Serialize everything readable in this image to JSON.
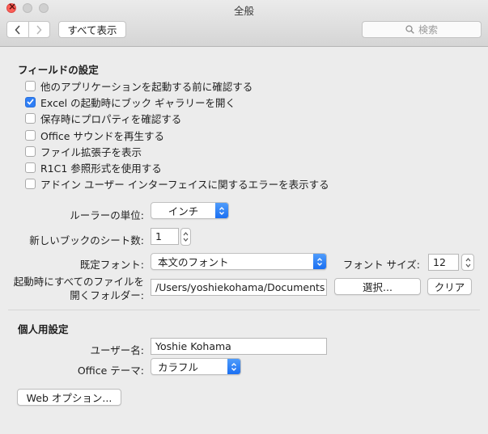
{
  "window": {
    "title": "全般"
  },
  "toolbar": {
    "show_all": "すべて表示",
    "search_placeholder": "検索"
  },
  "fields_section": {
    "title": "フィールドの設定",
    "options": [
      {
        "label": "他のアプリケーションを起動する前に確認する",
        "checked": false
      },
      {
        "label": "Excel の起動時にブック ギャラリーを開く",
        "checked": true
      },
      {
        "label": "保存時にプロパティを確認する",
        "checked": false
      },
      {
        "label": "Office サウンドを再生する",
        "checked": false
      },
      {
        "label": "ファイル拡張子を表示",
        "checked": false
      },
      {
        "label": "R1C1 参照形式を使用する",
        "checked": false
      },
      {
        "label": "アドイン ユーザー インターフェイスに関するエラーを表示する",
        "checked": false
      }
    ],
    "ruler_unit": {
      "label": "ルーラーの単位:",
      "value": "インチ"
    },
    "new_sheets": {
      "label": "新しいブックのシート数:",
      "value": "1"
    },
    "default_font": {
      "label": "既定フォント:",
      "value": "本文のフォント"
    },
    "font_size": {
      "label": "フォント サイズ:",
      "value": "12"
    },
    "startup_folder": {
      "label_line1": "起動時にすべてのファイルを",
      "label_line2": "開くフォルダー:",
      "value": "/Users/yoshiekohama/Documents",
      "select_label": "選択...",
      "clear_label": "クリア"
    }
  },
  "personal_section": {
    "title": "個人用設定",
    "user_name": {
      "label": "ユーザー名:",
      "value": "Yoshie Kohama"
    },
    "office_theme": {
      "label": "Office テーマ:",
      "value": "カラフル"
    }
  },
  "web_options_label": "Web オプション..."
}
